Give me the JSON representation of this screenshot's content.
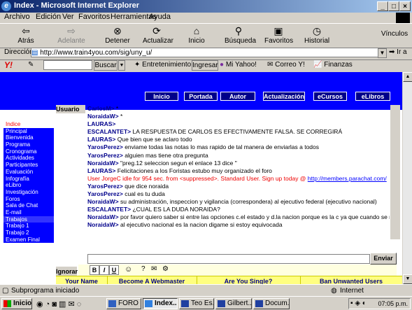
{
  "window": {
    "title": "Index - Microsoft Internet Explorer",
    "ie_glyph": "e"
  },
  "menu": [
    "Archivo",
    "Edición",
    "Ver",
    "Favoritos",
    "Herramientas",
    "Ayuda"
  ],
  "toolbar": {
    "back": "Atrás",
    "forward": "Adelante",
    "stop": "Detener",
    "refresh": "Actualizar",
    "home": "Inicio",
    "search": "Búsqueda",
    "favorites": "Favoritos",
    "history": "Historial",
    "links": "Vínculos"
  },
  "address": {
    "label": "Dirección",
    "url": "http://www.train4you.com/sig/uny_u/",
    "go": "Ir a"
  },
  "yahoo": {
    "search_button": "Buscar",
    "entertainment": "Entretenimiento",
    "login": "Ingresar",
    "my_yahoo": "Mi Yahoo!",
    "mail": "Correo Y!",
    "finance": "Finanzas"
  },
  "site_nav": [
    "Inicio",
    "Portada",
    "Autor",
    "Actualización",
    "eCursos",
    "eLibros"
  ],
  "sidebar": {
    "items": [
      "Indice",
      "Principal",
      "Bienvenida",
      "Programa",
      "Cronograma",
      "Actividades",
      "Participantes",
      "Evaluación",
      "Infografía",
      "eLibro",
      "Investigación",
      "Foros",
      "Sala de Chat",
      "E-mail",
      "Trabajos",
      "Trabajo 1",
      "Trabajo 2",
      "Examen Final"
    ]
  },
  "chat": {
    "users_header": "Usuario",
    "messages": [
      {
        "name": "CarlosM>",
        "text": "*"
      },
      {
        "name": "NoraidaW>",
        "text": "*"
      },
      {
        "name": "LAURAS>",
        "text": ""
      },
      {
        "name": "ESCALANTET>",
        "text": "LA RESPUESTA DE CARLOS ES EFECTIVAMENTE FALSA.  SE CORREGIRÁ"
      },
      {
        "name": "LAURAS>",
        "text": "Que bien que se aclaro todo"
      },
      {
        "name": "YarosPerez>",
        "text": "enviame todas las notas lo mas rapido de tal manera de enviarlas a todos"
      },
      {
        "name": "YarosPerez>",
        "text": "alguien mas tiene otra pregunta"
      },
      {
        "name": "NoraidaW>",
        "text": "\"preg.12 seleccion segun el enlace 13 dice \""
      },
      {
        "name": "LAURAS>",
        "text": "Felicitaciones a los Foristas estubo muy organizado el foro"
      },
      {
        "name": "",
        "text": "User JorgeC idle for 954 sec. from <suppressed>. Standard User. Sign up today @ ",
        "link": "http://members.parachat.com/"
      },
      {
        "name": "YarosPerez>",
        "text": "que dice noraida"
      },
      {
        "name": "YarosPerez>",
        "text": "cual es tu duda"
      },
      {
        "name": "NoraidaW>",
        "text": "su administración, inspeccion y vigilancia (correspondera) al ejecutivo federal (ejecutivo nacional)"
      },
      {
        "name": "ESCALANTET>",
        "text": "¿CUAL ES LA DUDA NORAIDA?"
      },
      {
        "name": "NoraidaW>",
        "text": "por favor quiero saber si entre las opciones c.el estado y d.la nacion porque es la c ya que cuando se refiere"
      },
      {
        "name": "NoraidaW>",
        "text": "al ejecutivo nacional es la nacion digame si estoy equivocada"
      }
    ],
    "send_button": "Enviar",
    "ignore_button": "Ignorar",
    "format_buttons": [
      "B",
      "I",
      "U"
    ]
  },
  "ads": [
    "Your Name",
    "Become A Webmaster",
    "Are You Single?",
    "Ban Unwanted Users"
  ],
  "status": {
    "text": "Subprograma iniciado",
    "zone": "Internet"
  },
  "taskbar": {
    "start": "Inicio",
    "tasks": [
      "FORO ...",
      "Index...",
      "Teo Es...",
      "Gilbert...",
      "Docum..."
    ],
    "clock": "07:05 p.m."
  },
  "colors": {
    "banner": "#0000ff",
    "nav_button": "#00008b",
    "ad_bar": "#ffff80",
    "warn": "#e00000"
  }
}
